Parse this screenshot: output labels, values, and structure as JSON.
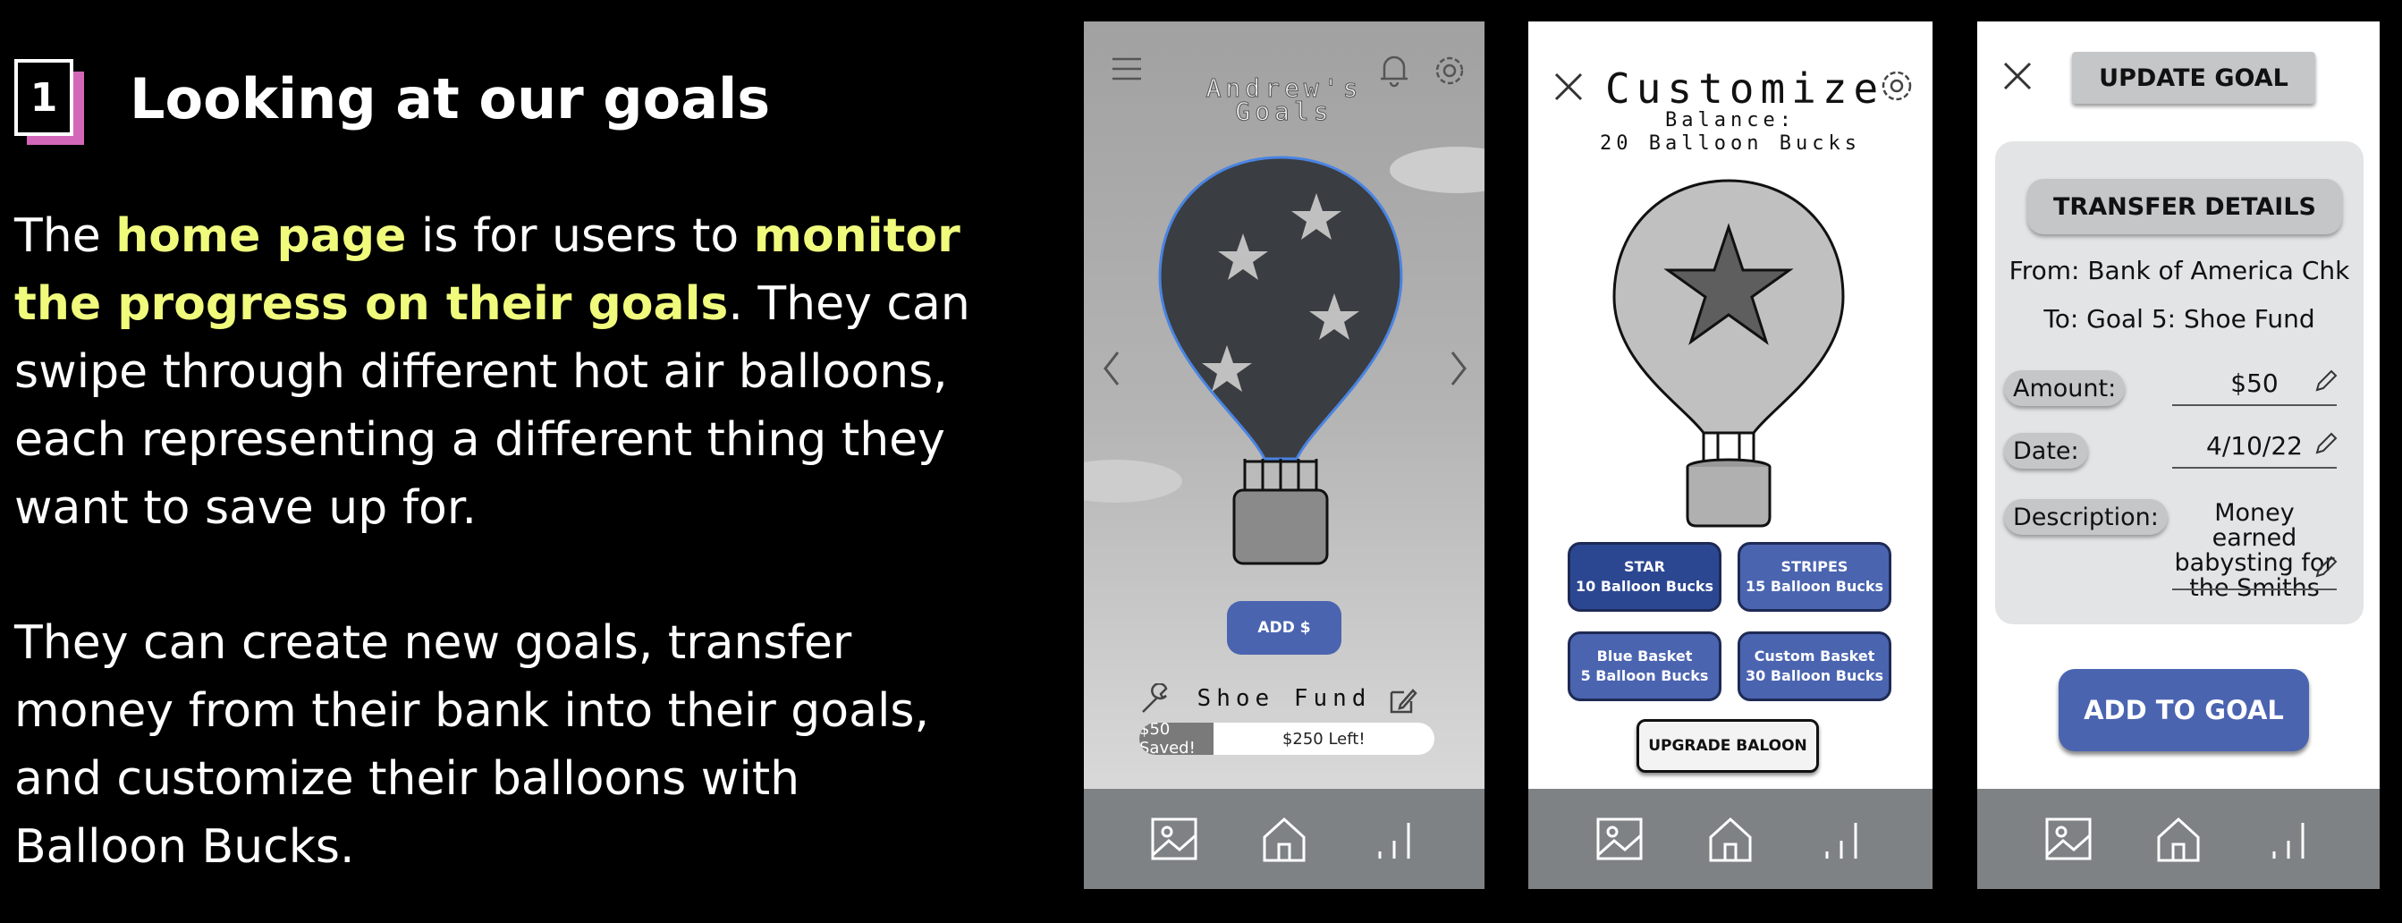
{
  "slide": {
    "step_number": "1",
    "heading": "Looking at our goals",
    "para1": {
      "t1": "The ",
      "h1": "home page",
      "t2": " is for users to ",
      "h2": "monitor the progress on their goals",
      "t3": ". They can swipe through different hot air balloons, each representing a different thing they want to save up for."
    },
    "para2": "They can create new goals, transfer money from their bank into their goals, and customize their balloons with Balloon Bucks.",
    "highlight_color": "#f0fb7c"
  },
  "home_screen": {
    "title_line1": "Andrew's",
    "title_line2": "Goals",
    "add_button": "ADD $",
    "goal_name": "Shoe Fund",
    "saved_label": "$50 Saved!",
    "left_label": "$250 Left!",
    "progress_fraction": 0.25,
    "icons": [
      "menu-icon",
      "bell-icon",
      "gear-icon",
      "chevron-left-icon",
      "chevron-right-icon",
      "wrench-icon",
      "edit-icon"
    ]
  },
  "customize_screen": {
    "title": "Customize",
    "balance_line1": "Balance:",
    "balance_line2": "20 Balloon Bucks",
    "options": [
      {
        "name": "STAR",
        "price": "10 Balloon Bucks"
      },
      {
        "name": "STRIPES",
        "price": "15 Balloon Bucks"
      },
      {
        "name": "Blue Basket",
        "price": "5 Balloon Bucks"
      },
      {
        "name": "Custom Basket",
        "price": "30 Balloon Bucks"
      }
    ],
    "upgrade_button": "UPGRADE BALOON"
  },
  "update_screen": {
    "top_button": "UPDATE GOAL",
    "section_button": "TRANSFER DETAILS",
    "from_line": "From: Bank of America Chk",
    "to_line": "To: Goal 5: Shoe Fund",
    "amount_label": "Amount:",
    "amount_value": "$50",
    "date_label": "Date:",
    "date_value": "4/10/22",
    "description_label": "Description:",
    "description_lines": [
      "Money earned",
      "babysting for",
      "the Smiths"
    ],
    "add_button": "ADD TO GOAL"
  },
  "nav_icons": [
    "image-icon",
    "home-icon",
    "stats-icon"
  ],
  "colors": {
    "accent": "#4a64b0",
    "nav": "#7e8285",
    "badge_shadow": "#d466b8"
  }
}
